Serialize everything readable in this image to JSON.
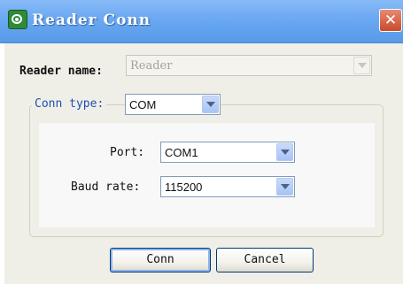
{
  "window": {
    "title": "Reader Conn",
    "app_icon": "eye-icon",
    "close_icon": "close-icon",
    "close_glyph": "✕"
  },
  "reader_name": {
    "label": "Reader name:",
    "value": "Reader",
    "enabled": false
  },
  "conn_type": {
    "label": "Conn type:",
    "value": "COM"
  },
  "port": {
    "label": "Port:",
    "value": "COM1"
  },
  "baud_rate": {
    "label": "Baud rate:",
    "value": "115200"
  },
  "buttons": {
    "conn": "Conn",
    "cancel": "Cancel"
  },
  "colors": {
    "titlebar": "#6aa8f2",
    "dialog_bg": "#efefe7",
    "close_button": "#c94a2c",
    "group_label": "#1f4fb0"
  }
}
